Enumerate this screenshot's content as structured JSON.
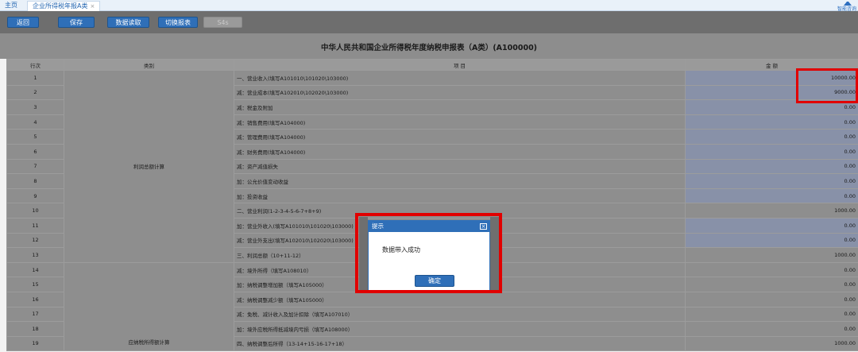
{
  "tabs": {
    "home": "主页",
    "active": "企业所得税年报A类",
    "close": "×",
    "topright_text": "智能咨询"
  },
  "toolbar": {
    "back": "返回",
    "save": "保存",
    "read_data": "数据读取",
    "switch_report": "切换报表",
    "disabled": "S4s"
  },
  "title": "中华人民共和国企业所得税年度纳税申报表（A类）(A100000)",
  "table": {
    "headers": [
      "行次",
      "类别",
      "项 目",
      "金 额"
    ],
    "categories": {
      "profit": "利润总额计算",
      "taxable": "应纳税所得额计算"
    },
    "rows": [
      {
        "no": "1",
        "item": "一、营业收入(填写A101010\\101020\\103000)",
        "amount": "10000.00"
      },
      {
        "no": "2",
        "item": "减：营业成本(填写A102010\\102020\\103000)",
        "amount": "9000.00"
      },
      {
        "no": "3",
        "item": "减：税金及附加",
        "amount": "0.00"
      },
      {
        "no": "4",
        "item": "减：销售费用(填写A104000)",
        "amount": "0.00"
      },
      {
        "no": "5",
        "item": "减：管理费用(填写A104000)",
        "amount": "0.00"
      },
      {
        "no": "6",
        "item": "减：财务费用(填写A104000)",
        "amount": "0.00"
      },
      {
        "no": "7",
        "item": "减：资产减值损失",
        "amount": "0.00"
      },
      {
        "no": "8",
        "item": "加：公允价值变动收益",
        "amount": "0.00"
      },
      {
        "no": "9",
        "item": "加：投资收益",
        "amount": "0.00"
      },
      {
        "no": "10",
        "item": "二、营业利润(1-2-3-4-5-6-7+8+9)",
        "amount": "1000.00"
      },
      {
        "no": "11",
        "item": "加：营业外收入(填写A101010\\101020\\103000)",
        "amount": "0.00"
      },
      {
        "no": "12",
        "item": "减：营业外支出(填写A102010\\102020\\103000)",
        "amount": "0.00"
      },
      {
        "no": "13",
        "item": "三、利润总额（10+11-12）",
        "amount": "1000.00"
      },
      {
        "no": "14",
        "item": "减：境外所得（填写A108010）",
        "amount": "0.00"
      },
      {
        "no": "15",
        "item": "加：纳税调整增加额（填写A105000）",
        "amount": "0.00"
      },
      {
        "no": "16",
        "item": "减：纳税调整减少额（填写A105000）",
        "amount": "0.00"
      },
      {
        "no": "17",
        "item": "减：免税、减计收入及加计扣除（填写A107010）",
        "amount": "0.00"
      },
      {
        "no": "18",
        "item": "加：境外应税所得抵减境内亏损（填写A108000）",
        "amount": "0.00"
      },
      {
        "no": "19",
        "item": "四、纳税调整后所得（13-14+15-16-17+18）",
        "amount": "1000.00"
      }
    ]
  },
  "modal": {
    "title": "提示",
    "message": "数据带入成功",
    "ok": "确定",
    "close": "×"
  },
  "colors": {
    "highlight": "#e10000",
    "accent": "#2f6fb8"
  }
}
